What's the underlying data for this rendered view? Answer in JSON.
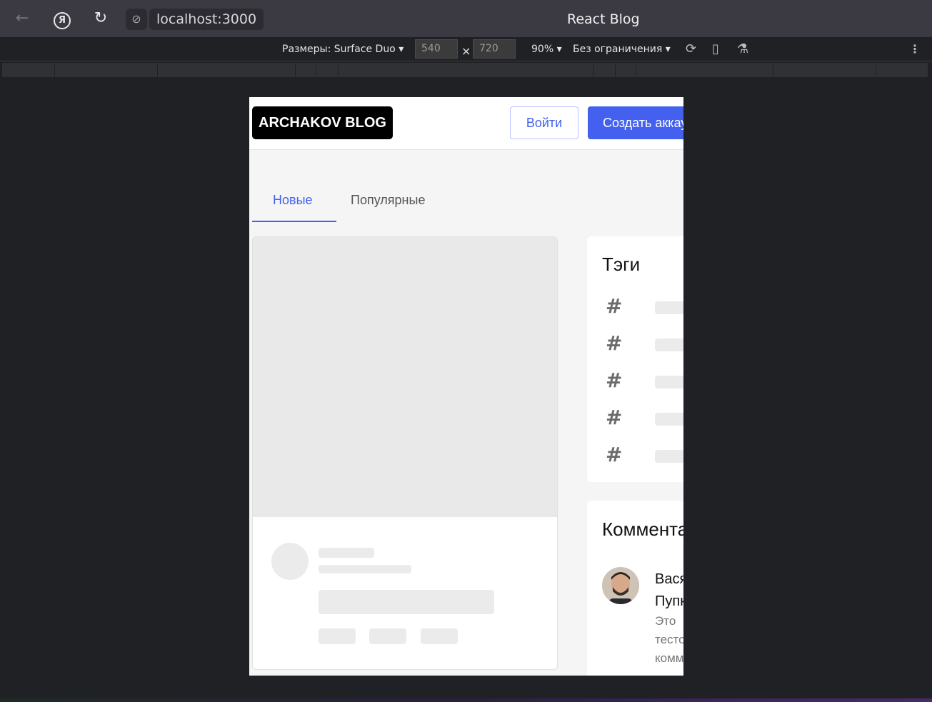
{
  "browser": {
    "url": "localhost:3000",
    "page_title": "React Blog"
  },
  "devtools": {
    "dimensions_label": "Размеры: Surface Duo",
    "width": "540",
    "height": "720",
    "times": "×",
    "zoom": "90%",
    "throttling": "Без ограничения"
  },
  "header": {
    "logo": "ARCHAKOV BLOG",
    "login": "Войти",
    "signup": "Создать аккаунт"
  },
  "tabs": [
    {
      "label": "Новые",
      "active": true
    },
    {
      "label": "Популярные",
      "active": false
    }
  ],
  "tags": {
    "title": "Тэги",
    "icon": "#"
  },
  "comments": {
    "title": "Комментарии",
    "items": [
      {
        "author": "Вася\nПупкин",
        "text": "Это\nтестовый\nкомментарий"
      }
    ]
  },
  "colors": {
    "accent": "#4361ee",
    "skeleton": "#ebebeb"
  }
}
